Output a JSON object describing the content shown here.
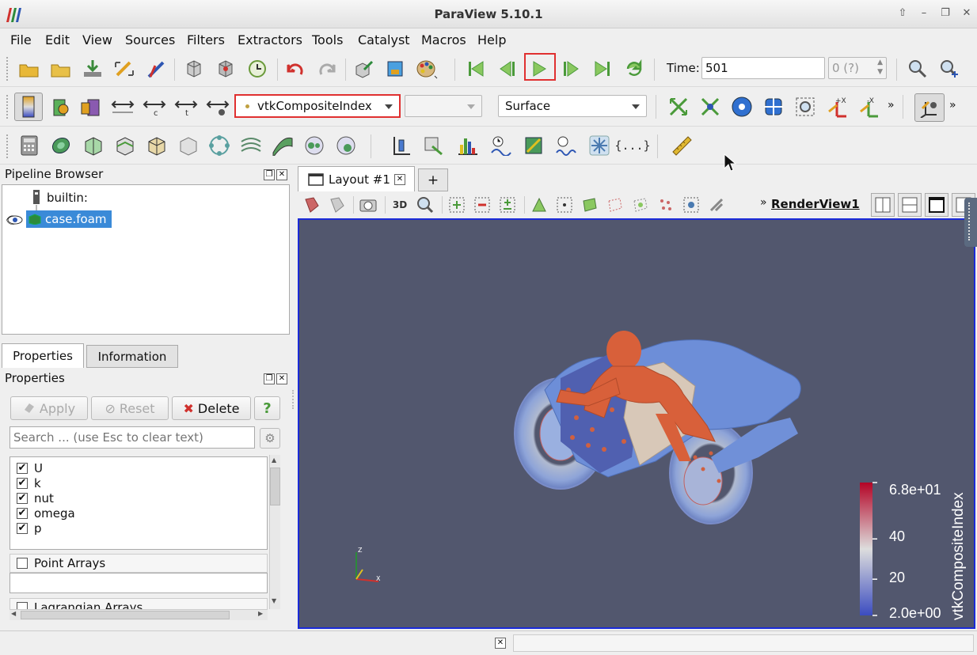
{
  "app_title": "ParaView 5.10.1",
  "menu": [
    "File",
    "Edit",
    "View",
    "Sources",
    "Filters",
    "Extractors",
    "Tools",
    "Catalyst",
    "Macros",
    "Help"
  ],
  "time": {
    "label": "Time:",
    "value": "501",
    "step": "0 (?)"
  },
  "coloring": {
    "array": "vtkCompositeIndex",
    "component": "",
    "representation": "Surface"
  },
  "pipeline": {
    "title": "Pipeline Browser",
    "items": [
      "builtin:",
      "case.foam"
    ]
  },
  "tabs": {
    "properties": "Properties",
    "information": "Information"
  },
  "properties": {
    "title": "Properties",
    "apply": "Apply",
    "reset": "Reset",
    "delete": "Delete",
    "help": "?",
    "search_placeholder": "Search ... (use Esc to clear text)",
    "cell_arrays": [
      "U",
      "k",
      "nut",
      "omega",
      "p"
    ],
    "point_arrays": "Point Arrays",
    "lagrangian_arrays": "Lagrangian Arrays"
  },
  "layout": {
    "tab": "Layout #1",
    "add_tab": "+",
    "view_name": "RenderView1",
    "btn_3d": "3D"
  },
  "colorbar": {
    "title": "vtkCompositeIndex",
    "labels": [
      "6.8e+01",
      "40",
      "20",
      "2.0e+00"
    ],
    "max": 68,
    "min": 2,
    "ticks": [
      68,
      40,
      20,
      2
    ]
  },
  "colors": {
    "viewport_bg": "#52576e",
    "accent_red": "#e03030",
    "rider": "#d8603a",
    "bike": "#6d8ed8"
  }
}
